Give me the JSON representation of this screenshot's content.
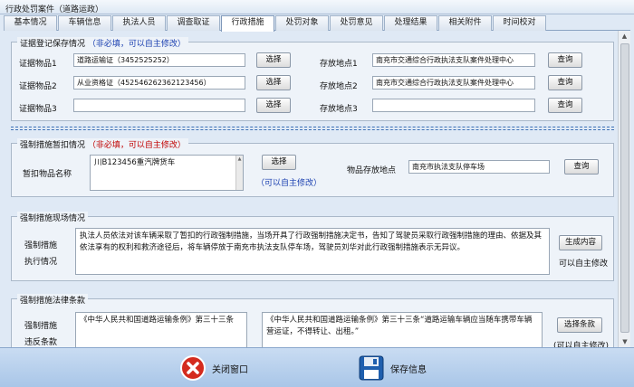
{
  "window": {
    "title": "行政处罚案件（道路运政）"
  },
  "tabs": [
    {
      "label": "基本情况"
    },
    {
      "label": "车辆信息"
    },
    {
      "label": "执法人员"
    },
    {
      "label": "调查取证"
    },
    {
      "label": "行政措施",
      "active": true
    },
    {
      "label": "处罚对象"
    },
    {
      "label": "处罚意见"
    },
    {
      "label": "处理结果"
    },
    {
      "label": "相关附件"
    },
    {
      "label": "时间校对"
    }
  ],
  "evidence": {
    "title": "证据登记保存情况",
    "note": "（非必填，可以自主修改）",
    "rows": [
      {
        "label": "证据物品1",
        "value": "道路运输证（3452525252）",
        "select_label": "选择",
        "location_label": "存放地点1",
        "location_value": "南充市交通综合行政执法支队案件处理中心",
        "query_label": "查询"
      },
      {
        "label": "证据物品2",
        "value": "从业资格证（452546262362123456）",
        "select_label": "选择",
        "location_label": "存放地点2",
        "location_value": "南充市交通综合行政执法支队案件处理中心",
        "query_label": "查询"
      },
      {
        "label": "证据物品3",
        "value": "",
        "select_label": "选择",
        "location_label": "存放地点3",
        "location_value": "",
        "query_label": "查询"
      }
    ]
  },
  "seizure": {
    "title": "强制措施暂扣情况",
    "note": "（非必填，可以自主修改）",
    "item_label": "暂扣物品名称",
    "item_value": "川B123456重汽牌货车",
    "select_label": "选择",
    "select_hint": "（可以自主修改）",
    "location_label": "物品存放地点",
    "location_value": "南充市执法支队停车场",
    "query_label": "查询"
  },
  "scene": {
    "title": "强制措施现场情况",
    "label_line1": "强制措施",
    "label_line2": "执行情况",
    "text": "执法人员依法对该车辆采取了暂扣的行政强制措施，当场开具了行政强制措施决定书，告知了驾驶员采取行政强制措施的理由、依据及其依法享有的权利和救济途径后，将车辆停放于南充市执法支队停车场，驾驶员刘华对此行政强制措施表示无异议。",
    "generate_label": "生成内容",
    "hint": "可以自主修改"
  },
  "law": {
    "title": "强制措施法律条款",
    "label_line1": "强制措施",
    "label_line2": "违反条款",
    "violated_text": "《中华人民共和国道路运输条例》第三十三条",
    "basis_text": "《中华人民共和国道路运输条例》第三十三条“道路运输车辆应当随车携带车辆营运证，不得转让、出租。”",
    "select_label": "选择条款",
    "hint": "(可以自主修改)"
  },
  "footer": {
    "close_label": "关闭窗口",
    "save_label": "保存信息"
  },
  "colors": {
    "note_red": "#c00000",
    "note_blue": "#1a3fb0",
    "separator": "#3b6fb6",
    "close_icon": "#d42b1e",
    "save_icon": "#1f5fae"
  }
}
